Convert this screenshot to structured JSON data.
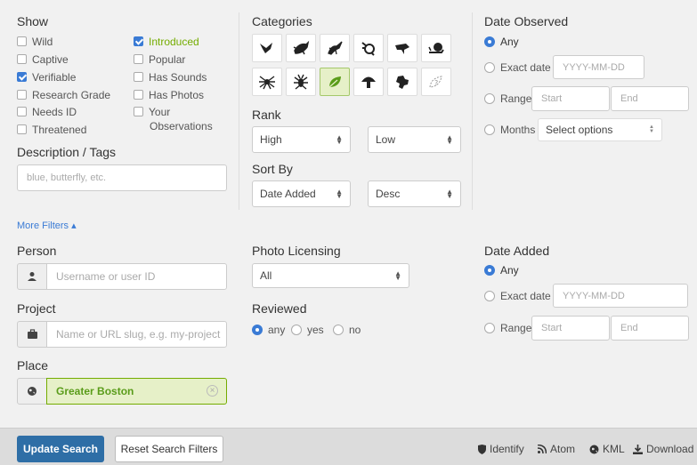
{
  "show": {
    "heading": "Show",
    "col1": [
      {
        "label": "Wild",
        "checked": false
      },
      {
        "label": "Captive",
        "checked": false
      },
      {
        "label": "Verifiable",
        "checked": true
      },
      {
        "label": "Research Grade",
        "checked": false
      },
      {
        "label": "Needs ID",
        "checked": false
      },
      {
        "label": "Threatened",
        "checked": false
      }
    ],
    "col2": [
      {
        "label": "Introduced",
        "checked": true
      },
      {
        "label": "Popular",
        "checked": false
      },
      {
        "label": "Has Sounds",
        "checked": false
      },
      {
        "label": "Has Photos",
        "checked": false
      },
      {
        "label": "Your",
        "checked": false
      }
    ],
    "col2_extra": "Observations"
  },
  "description": {
    "heading": "Description / Tags",
    "placeholder": "blue, butterfly, etc."
  },
  "categories": {
    "heading": "Categories",
    "icons": [
      "birds-icon",
      "amphibians-icon",
      "reptiles-icon",
      "mammals-icon",
      "ray-finned-fishes-icon",
      "mollusks-icon",
      "arachnids-icon",
      "insects-icon",
      "plants-icon",
      "fungi-icon",
      "protozoans-icon",
      "unknown-icon"
    ],
    "selected": "plants-icon"
  },
  "rank": {
    "heading": "Rank",
    "high": "High",
    "low": "Low"
  },
  "sort": {
    "heading": "Sort By",
    "field": "Date Added",
    "order": "Desc"
  },
  "date_observed": {
    "heading": "Date Observed",
    "any": "Any",
    "exact": "Exact date",
    "exact_placeholder": "YYYY-MM-DD",
    "range": "Range",
    "start": "Start",
    "end": "End",
    "months": "Months",
    "months_select": "Select options"
  },
  "more_filters": "More Filters ▴",
  "person": {
    "heading": "Person",
    "placeholder": "Username or user ID"
  },
  "project": {
    "heading": "Project",
    "placeholder": "Name or URL slug, e.g. my-project"
  },
  "place": {
    "heading": "Place",
    "value": "Greater Boston"
  },
  "photo_licensing": {
    "heading": "Photo Licensing",
    "value": "All"
  },
  "reviewed": {
    "heading": "Reviewed",
    "any": "any",
    "yes": "yes",
    "no": "no"
  },
  "date_added": {
    "heading": "Date Added",
    "any": "Any",
    "exact": "Exact date",
    "exact_placeholder": "YYYY-MM-DD",
    "range": "Range",
    "start": "Start",
    "end": "End"
  },
  "footer": {
    "update": "Update Search",
    "reset": "Reset Search Filters",
    "identify": "Identify",
    "atom": "Atom",
    "kml": "KML",
    "download": "Download"
  },
  "colors": {
    "accent": "#74ac00",
    "blue": "#3a7bd5",
    "button": "#2e6ea6"
  }
}
